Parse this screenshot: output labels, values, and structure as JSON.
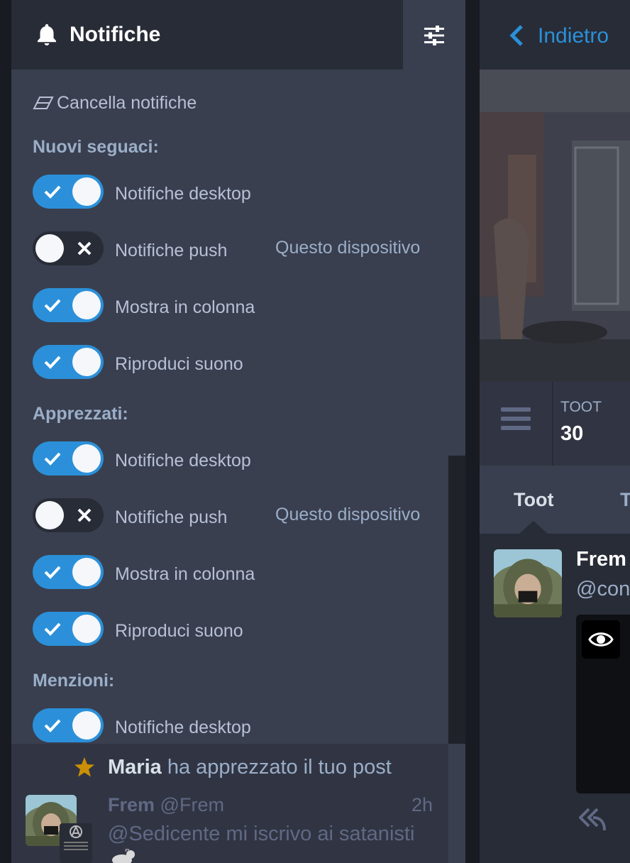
{
  "notifications_column": {
    "title": "Notifiche",
    "clear_label": "Cancella notifiche",
    "sections": [
      {
        "title": "Nuovi seguaci:",
        "options": [
          {
            "label": "Notifiche desktop",
            "enabled": true
          },
          {
            "label": "Notifiche push",
            "enabled": false,
            "extra": "Questo dispositivo"
          },
          {
            "label": "Mostra in colonna",
            "enabled": true
          },
          {
            "label": "Riproduci suono",
            "enabled": true
          }
        ]
      },
      {
        "title": "Apprezzati:",
        "options": [
          {
            "label": "Notifiche desktop",
            "enabled": true
          },
          {
            "label": "Notifiche push",
            "enabled": false,
            "extra": "Questo dispositivo"
          },
          {
            "label": "Mostra in colonna",
            "enabled": true
          },
          {
            "label": "Riproduci suono",
            "enabled": true
          }
        ]
      },
      {
        "title": "Menzioni:",
        "options": [
          {
            "label": "Notifiche desktop",
            "enabled": true
          }
        ]
      }
    ],
    "notification": {
      "actor": "Maria",
      "action": "ha apprezzato il tuo post",
      "status_display_name": "Frem",
      "status_acct": "@Frem",
      "status_time": "2h",
      "status_text": "@Sedicente mi iscrivo ai satanisti"
    }
  },
  "profile_column": {
    "back_label": "Indietro",
    "stat_label": "TOOT",
    "stat_value": "30",
    "tab_active": "Toot",
    "tab_next": "T",
    "status_name": "Frem",
    "status_acct": "@con"
  },
  "colors": {
    "accent": "#2b90d9",
    "panel": "#393f4f",
    "background": "#282c37",
    "star": "#ca8f04"
  }
}
